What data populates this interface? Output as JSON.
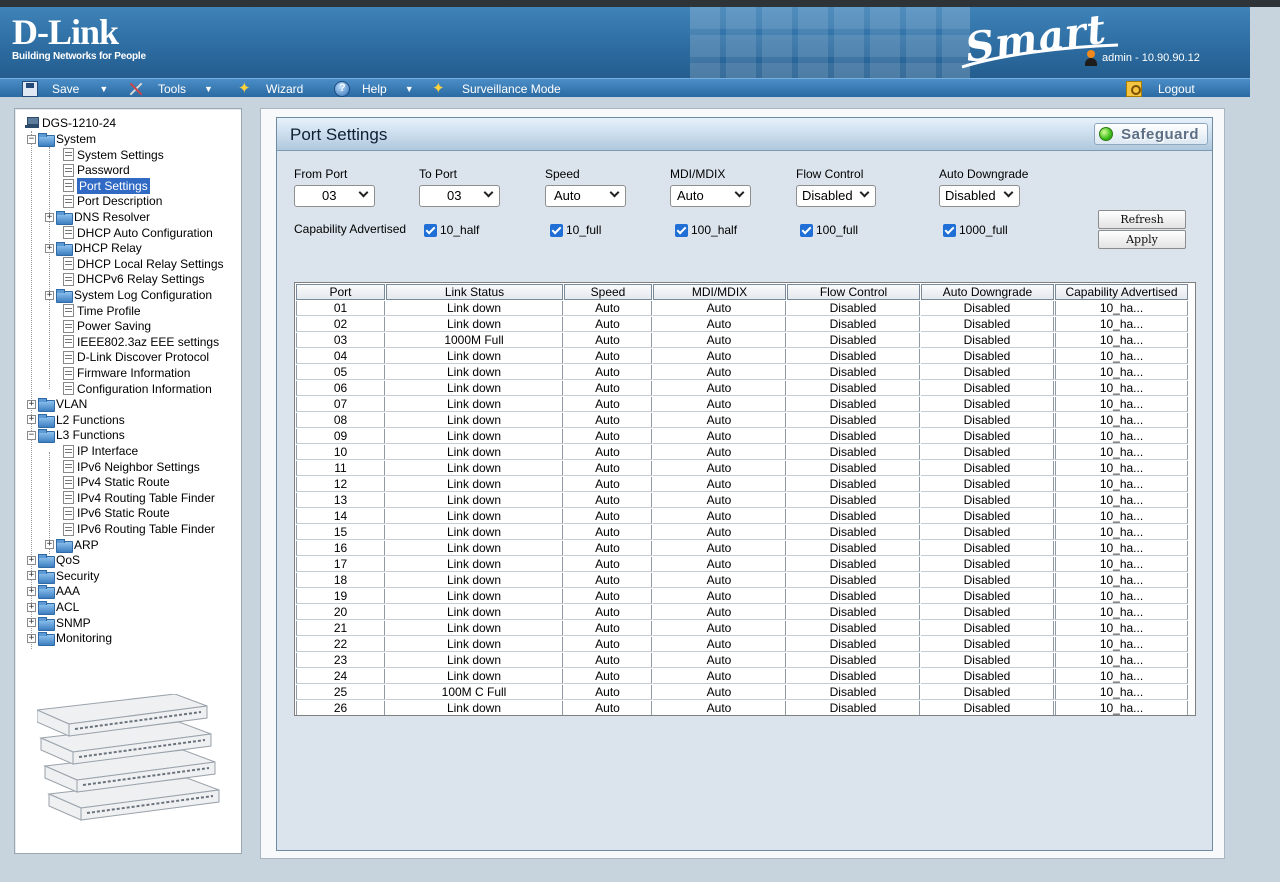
{
  "header": {
    "logo_main": "D-Link",
    "logo_sub": "Building Networks for People",
    "brand": "Smart",
    "user": "admin - 10.90.90.12"
  },
  "menu": {
    "save": "Save",
    "tools": "Tools",
    "wizard": "Wizard",
    "help": "Help",
    "surveillance": "Surveillance Mode",
    "logout": "Logout"
  },
  "tree": {
    "root": "DGS-1210-24",
    "system": "System",
    "system_items": [
      "System Settings",
      "Password",
      "Port Settings",
      "Port Description",
      "DNS Resolver",
      "DHCP Auto Configuration",
      "DHCP Relay",
      "DHCP Local Relay Settings",
      "DHCPv6 Relay Settings",
      "System Log Configuration",
      "Time Profile",
      "Power Saving",
      "IEEE802.3az EEE settings",
      "D-Link Discover Protocol",
      "Firmware Information",
      "Configuration Information"
    ],
    "vlan": "VLAN",
    "l2": "L2 Functions",
    "l3": "L3 Functions",
    "l3_items": [
      "IP Interface",
      "IPv6 Neighbor Settings",
      "IPv4 Static Route",
      "IPv4 Routing Table Finder",
      "IPv6 Static Route",
      "IPv6 Routing Table Finder",
      "ARP"
    ],
    "qos": "QoS",
    "security": "Security",
    "aaa": "AAA",
    "acl": "ACL",
    "snmp": "SNMP",
    "monitoring": "Monitoring"
  },
  "page": {
    "title": "Port Settings",
    "safeguard": "Safeguard"
  },
  "form": {
    "from_port_label": "From Port",
    "from_port_value": "03",
    "to_port_label": "To Port",
    "to_port_value": "03",
    "speed_label": "Speed",
    "speed_value": "Auto",
    "mdi_label": "MDI/MDIX",
    "mdi_value": "Auto",
    "flow_label": "Flow Control",
    "flow_value": "Disabled",
    "auto_down_label": "Auto Downgrade",
    "auto_down_value": "Disabled",
    "cap_label": "Capability Advertised",
    "cap_options": [
      "10_half",
      "10_full",
      "100_half",
      "100_full",
      "1000_full"
    ],
    "refresh": "Refresh",
    "apply": "Apply"
  },
  "table": {
    "headers": [
      "Port",
      "Link Status",
      "Speed",
      "MDI/MDIX",
      "Flow Control",
      "Auto Downgrade",
      "Capability Advertised"
    ],
    "rows": [
      [
        "01",
        "Link down",
        "Auto",
        "Auto",
        "Disabled",
        "Disabled",
        "10_ha..."
      ],
      [
        "02",
        "Link down",
        "Auto",
        "Auto",
        "Disabled",
        "Disabled",
        "10_ha..."
      ],
      [
        "03",
        "1000M Full",
        "Auto",
        "Auto",
        "Disabled",
        "Disabled",
        "10_ha..."
      ],
      [
        "04",
        "Link down",
        "Auto",
        "Auto",
        "Disabled",
        "Disabled",
        "10_ha..."
      ],
      [
        "05",
        "Link down",
        "Auto",
        "Auto",
        "Disabled",
        "Disabled",
        "10_ha..."
      ],
      [
        "06",
        "Link down",
        "Auto",
        "Auto",
        "Disabled",
        "Disabled",
        "10_ha..."
      ],
      [
        "07",
        "Link down",
        "Auto",
        "Auto",
        "Disabled",
        "Disabled",
        "10_ha..."
      ],
      [
        "08",
        "Link down",
        "Auto",
        "Auto",
        "Disabled",
        "Disabled",
        "10_ha..."
      ],
      [
        "09",
        "Link down",
        "Auto",
        "Auto",
        "Disabled",
        "Disabled",
        "10_ha..."
      ],
      [
        "10",
        "Link down",
        "Auto",
        "Auto",
        "Disabled",
        "Disabled",
        "10_ha..."
      ],
      [
        "11",
        "Link down",
        "Auto",
        "Auto",
        "Disabled",
        "Disabled",
        "10_ha..."
      ],
      [
        "12",
        "Link down",
        "Auto",
        "Auto",
        "Disabled",
        "Disabled",
        "10_ha..."
      ],
      [
        "13",
        "Link down",
        "Auto",
        "Auto",
        "Disabled",
        "Disabled",
        "10_ha..."
      ],
      [
        "14",
        "Link down",
        "Auto",
        "Auto",
        "Disabled",
        "Disabled",
        "10_ha..."
      ],
      [
        "15",
        "Link down",
        "Auto",
        "Auto",
        "Disabled",
        "Disabled",
        "10_ha..."
      ],
      [
        "16",
        "Link down",
        "Auto",
        "Auto",
        "Disabled",
        "Disabled",
        "10_ha..."
      ],
      [
        "17",
        "Link down",
        "Auto",
        "Auto",
        "Disabled",
        "Disabled",
        "10_ha..."
      ],
      [
        "18",
        "Link down",
        "Auto",
        "Auto",
        "Disabled",
        "Disabled",
        "10_ha..."
      ],
      [
        "19",
        "Link down",
        "Auto",
        "Auto",
        "Disabled",
        "Disabled",
        "10_ha..."
      ],
      [
        "20",
        "Link down",
        "Auto",
        "Auto",
        "Disabled",
        "Disabled",
        "10_ha..."
      ],
      [
        "21",
        "Link down",
        "Auto",
        "Auto",
        "Disabled",
        "Disabled",
        "10_ha..."
      ],
      [
        "22",
        "Link down",
        "Auto",
        "Auto",
        "Disabled",
        "Disabled",
        "10_ha..."
      ],
      [
        "23",
        "Link down",
        "Auto",
        "Auto",
        "Disabled",
        "Disabled",
        "10_ha..."
      ],
      [
        "24",
        "Link down",
        "Auto",
        "Auto",
        "Disabled",
        "Disabled",
        "10_ha..."
      ],
      [
        "25",
        "100M C Full",
        "Auto",
        "Auto",
        "Disabled",
        "Disabled",
        "10_ha..."
      ],
      [
        "26",
        "Link down",
        "Auto",
        "Auto",
        "Disabled",
        "Disabled",
        "10_ha..."
      ]
    ]
  }
}
